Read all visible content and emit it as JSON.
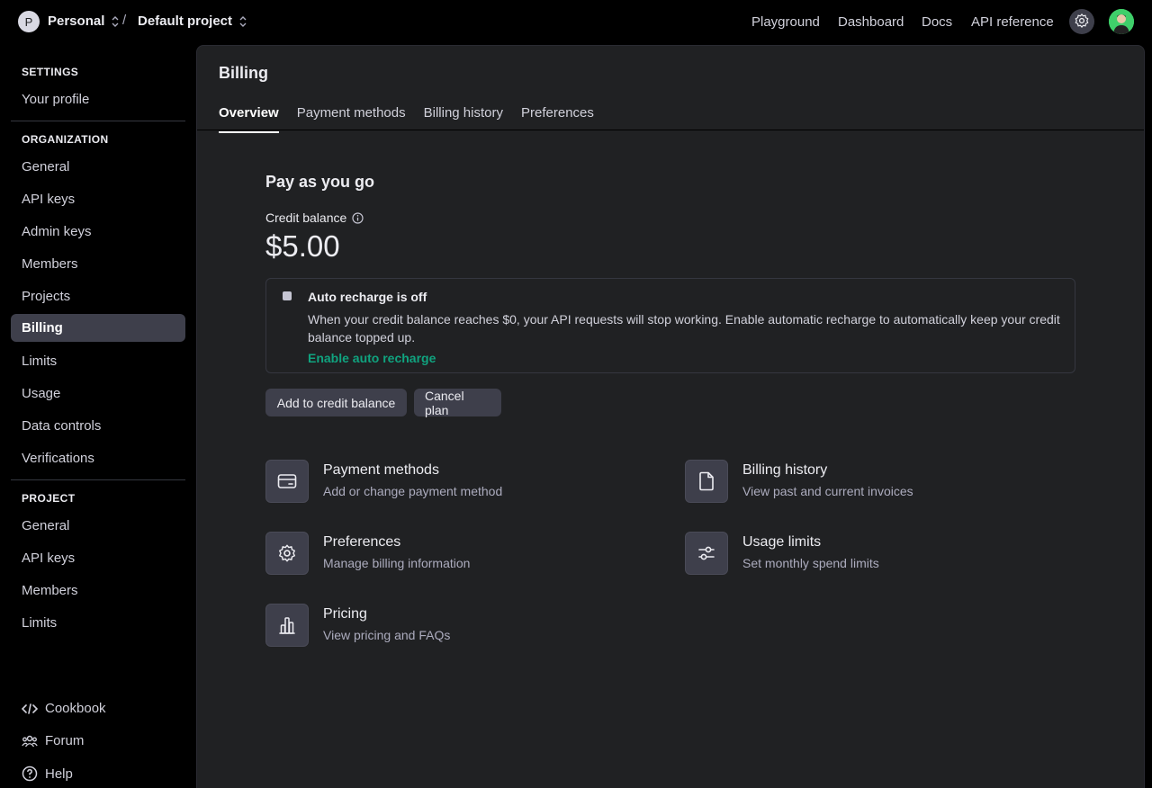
{
  "topbar": {
    "org_initial": "P",
    "org_name": "Personal",
    "separator": "/",
    "project_name": "Default project",
    "nav": [
      "Playground",
      "Dashboard",
      "Docs",
      "API reference"
    ]
  },
  "sidebar": {
    "settings_title": "SETTINGS",
    "settings_items": [
      "Your profile"
    ],
    "org_title": "ORGANIZATION",
    "org_items": [
      "General",
      "API keys",
      "Admin keys",
      "Members",
      "Projects",
      "Billing",
      "Limits",
      "Usage",
      "Data controls",
      "Verifications"
    ],
    "active_item": "Billing",
    "project_title": "PROJECT",
    "project_items": [
      "General",
      "API keys",
      "Members",
      "Limits"
    ],
    "footer": [
      "Cookbook",
      "Forum",
      "Help"
    ]
  },
  "main": {
    "title": "Billing",
    "tabs": [
      "Overview",
      "Payment methods",
      "Billing history",
      "Preferences"
    ],
    "active_tab": "Overview",
    "plan_title": "Pay as you go",
    "credit_label": "Credit balance",
    "credit_value": "$5.00",
    "recharge": {
      "title": "Auto recharge is off",
      "description": "When your credit balance reaches $0, your API requests will stop working. Enable automatic recharge to automatically keep your credit balance topped up.",
      "link": "Enable auto recharge"
    },
    "buttons": {
      "add_credit": "Add to credit balance",
      "cancel": "Cancel plan"
    },
    "cards": [
      {
        "title": "Payment methods",
        "subtitle": "Add or change payment method",
        "icon": "credit-card-icon"
      },
      {
        "title": "Billing history",
        "subtitle": "View past and current invoices",
        "icon": "document-icon"
      },
      {
        "title": "Preferences",
        "subtitle": "Manage billing information",
        "icon": "gear-icon"
      },
      {
        "title": "Usage limits",
        "subtitle": "Set monthly spend limits",
        "icon": "sliders-icon"
      },
      {
        "title": "Pricing",
        "subtitle": "View pricing and FAQs",
        "icon": "bar-chart-icon"
      }
    ]
  },
  "colors": {
    "background": "#000000",
    "panel": "#202123",
    "active_item": "#3e3f4b",
    "link_green": "#10a37f"
  }
}
